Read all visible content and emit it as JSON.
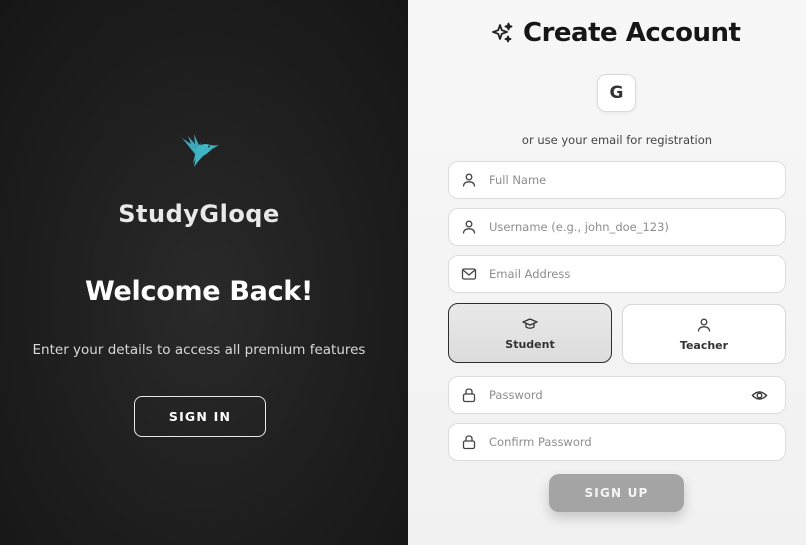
{
  "brand": {
    "name": "StudyGloqe",
    "logo_icon": "hummingbird-icon",
    "logo_color": "#3fb6c6"
  },
  "welcome": {
    "heading": "Welcome Back!",
    "subtitle": "Enter your details to access all premium features",
    "signin_label": "SIGN IN"
  },
  "form": {
    "title": "Create Account",
    "title_icon": "sparkles-icon",
    "google_label": "G",
    "divider_text": "or use your email for registration",
    "fields": {
      "full_name": {
        "placeholder": "Full Name",
        "value": "",
        "icon": "user-icon"
      },
      "username": {
        "placeholder": "Username (e.g., john_doe_123)",
        "value": "",
        "icon": "user-icon"
      },
      "email": {
        "placeholder": "Email Address",
        "value": "",
        "icon": "mail-icon"
      },
      "password": {
        "placeholder": "Password",
        "value": "",
        "icon": "lock-icon"
      },
      "confirm_password": {
        "placeholder": "Confirm Password",
        "value": "",
        "icon": "lock-icon"
      }
    },
    "roles": [
      {
        "label": "Student",
        "icon": "graduation-cap-icon",
        "selected": true
      },
      {
        "label": "Teacher",
        "icon": "user-icon",
        "selected": false
      }
    ],
    "signup_label": "SIGN UP"
  },
  "colors": {
    "left_bg": "#1f1f1f",
    "right_bg": "#f4f4f4",
    "signup_disabled": "#a4a4a4"
  }
}
